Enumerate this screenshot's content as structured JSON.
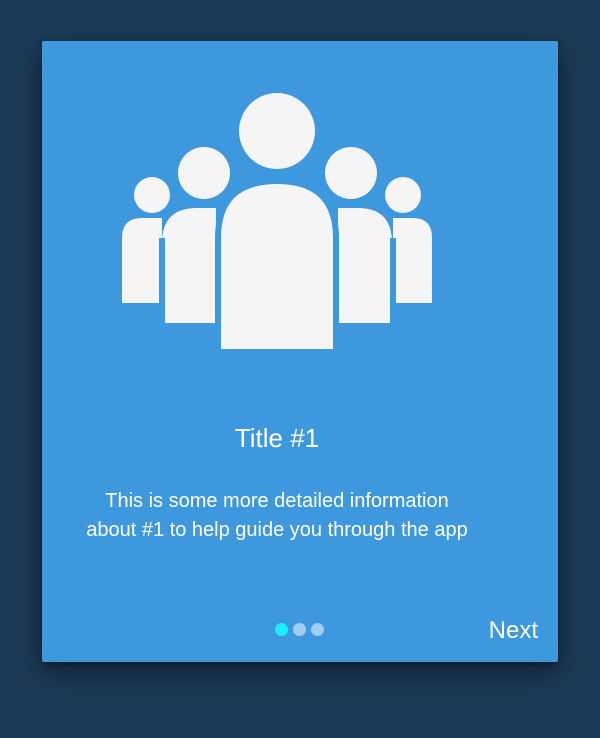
{
  "onboarding": {
    "title": "Title #1",
    "description_line1": "This is some more detailed information",
    "description_line2": "about #1 to help guide you through the app",
    "next_label": "Next",
    "icon": "group-people-icon",
    "pager": {
      "total": 3,
      "active_index": 0
    }
  },
  "colors": {
    "background": "#1c3a57",
    "card": "#3d98dd",
    "icon": "#f5f5f5",
    "text": "#ffffff",
    "active_dot": "#19f0ff",
    "inactive_dot": "#b7d5f0"
  }
}
